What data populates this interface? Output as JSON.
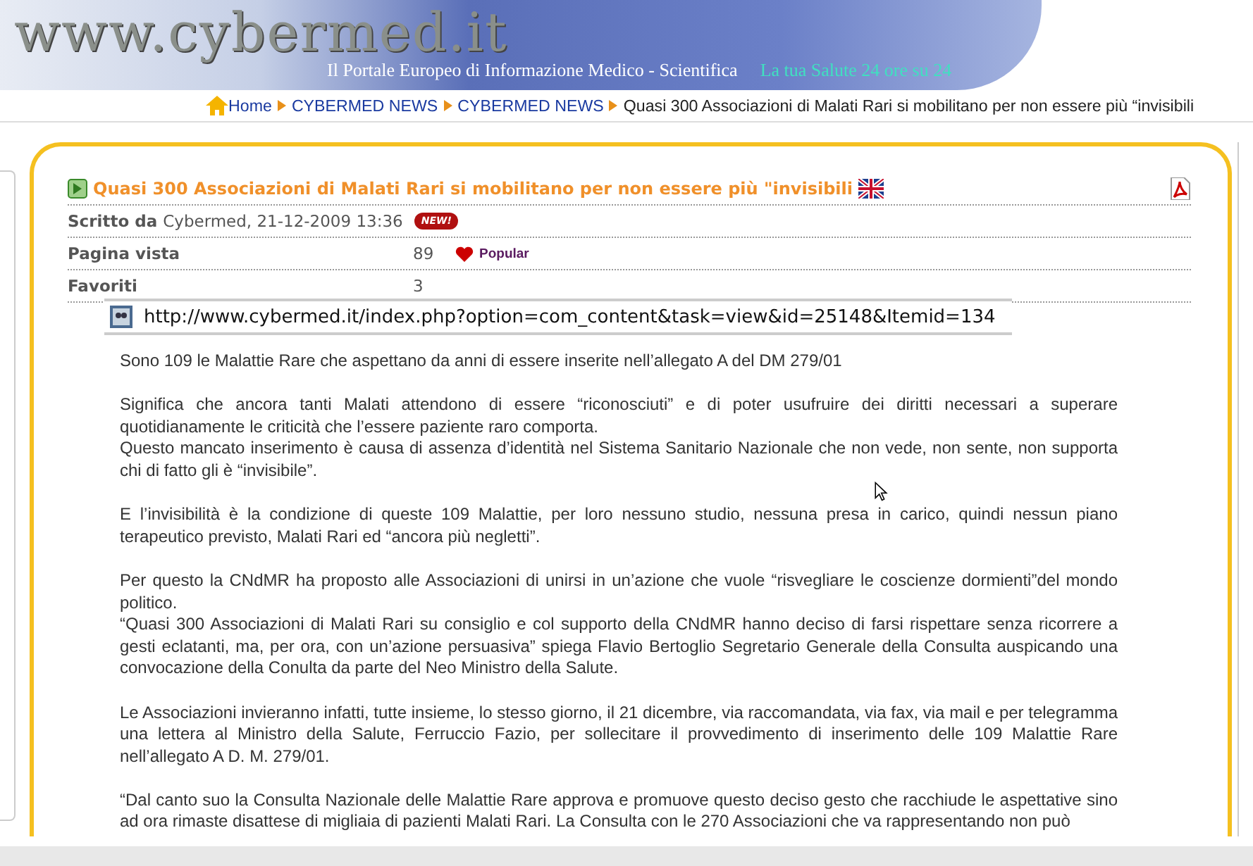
{
  "header": {
    "logo": "www.cybermed.it",
    "subtitle": "Il Portale Europeo di Informazione Medico - Scientifica",
    "tagline": "La tua Salute 24 ore su 24"
  },
  "breadcrumb": [
    {
      "label": "Home",
      "kind": "home"
    },
    {
      "label": "CYBERMED NEWS",
      "kind": "link"
    },
    {
      "label": "CYBERMED NEWS",
      "kind": "link"
    },
    {
      "label": "Quasi 300 Associazioni di Malati Rari si mobilitano per non essere più “invisibili",
      "kind": "current"
    }
  ],
  "article": {
    "title": "Quasi 300 Associazioni di Malati Rari si mobilitano per non essere più \"invisibili",
    "meta": [
      {
        "label": "Scritto da",
        "value": "Cybermed, 21-12-2009 13:36",
        "badge": "NEW!",
        "kind": "author"
      },
      {
        "label": "Pagina vista",
        "value": "89",
        "badge": "Popular",
        "kind": "hits"
      },
      {
        "label": "Favoriti",
        "value": "3",
        "kind": "plain"
      }
    ],
    "url_tooltip": "http://www.cybermed.it/index.php?option=com_content&task=view&id=25148&Itemid=134",
    "paragraphs": [
      {
        "texts": [
          "Sono 109 le Malattie Rare che aspettano da anni di essere inserite nell’allegato A del DM 279/01"
        ]
      },
      {
        "texts": [
          "Significa che ancora tanti Malati attendono di essere “riconosciuti” e di poter usufruire dei diritti necessari a superare quotidianamente le criticità che l’essere paziente raro comporta.",
          "Questo mancato inserimento è causa di assenza d’identità nel Sistema Sanitario Nazionale che non vede, non sente, non supporta chi di fatto gli è “invisibile”."
        ]
      },
      {
        "texts": [
          "E l’invisibilità è la condizione di queste 109 Malattie, per loro nessuno studio, nessuna presa in carico, quindi nessun piano terapeutico previsto, Malati Rari ed “ancora più negletti”."
        ]
      },
      {
        "texts": [
          "Per questo la CNdMR ha proposto alle Associazioni di unirsi in un’azione che vuole “risvegliare le coscienze dormienti”del mondo politico.",
          "“Quasi 300 Associazioni di Malati Rari su consiglio e col supporto della CNdMR hanno deciso di farsi rispettare senza ricorrere a gesti eclatanti, ma, per ora, con un’azione persuasiva” spiega Flavio Bertoglio Segretario Generale della Consulta auspicando una convocazione della Conulta da parte del Neo Ministro della Salute."
        ]
      },
      {
        "texts": [
          "Le Associazioni invieranno infatti, tutte insieme, lo stesso giorno, il 21 dicembre, via raccomandata, via fax, via mail e per telegramma una lettera al Ministro della Salute, Ferruccio Fazio, per sollecitare  il provvedimento di inserimento delle 109 Malattie Rare nell’allegato A D. M. 279/01."
        ]
      },
      {
        "texts": [
          "“Dal canto suo la Consulta Nazionale delle Malattie Rare approva e promuove questo deciso gesto che racchiude le aspettative sino ad ora rimaste disattese di migliaia di pazienti Malati Rari. La Consulta con le 270 Associazioni che va rappresentando non può"
        ]
      }
    ]
  }
}
